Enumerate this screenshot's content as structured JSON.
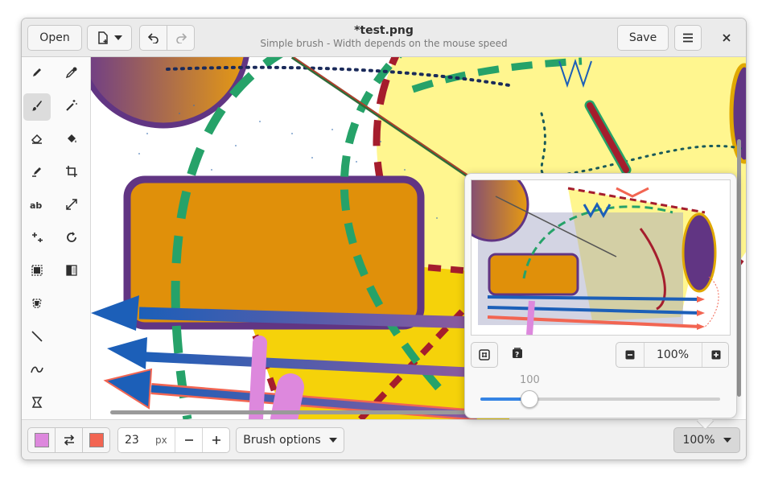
{
  "header": {
    "open_label": "Open",
    "title": "*test.png",
    "subtitle": "Simple brush - Width depends on the mouse speed",
    "save_label": "Save"
  },
  "tools": [
    {
      "name": "pencil",
      "icon": "pencil-icon",
      "active": false
    },
    {
      "name": "color-picker",
      "icon": "eyedropper-icon",
      "active": false
    },
    {
      "name": "brush",
      "icon": "brush-icon",
      "active": true
    },
    {
      "name": "magic-wand",
      "icon": "magic-wand-icon",
      "active": false
    },
    {
      "name": "eraser",
      "icon": "eraser-icon",
      "active": false
    },
    {
      "name": "paint-bucket",
      "icon": "paint-bucket-icon",
      "active": false
    },
    {
      "name": "highlighter",
      "icon": "highlighter-icon",
      "active": false
    },
    {
      "name": "crop",
      "icon": "crop-icon",
      "active": false
    },
    {
      "name": "text",
      "icon": "text-icon",
      "active": false
    },
    {
      "name": "scale",
      "icon": "scale-icon",
      "active": false
    },
    {
      "name": "points",
      "icon": "points-icon",
      "active": false
    },
    {
      "name": "rotate",
      "icon": "rotate-icon",
      "active": false
    },
    {
      "name": "rect-select",
      "icon": "rect-select-icon",
      "active": false
    },
    {
      "name": "filters",
      "icon": "filters-icon",
      "active": false
    },
    {
      "name": "free-select",
      "icon": "free-select-icon",
      "active": false
    },
    {
      "name": "line",
      "icon": "line-icon",
      "active": false
    },
    {
      "name": "curve",
      "icon": "curve-icon",
      "active": false
    },
    {
      "name": "free-shape",
      "icon": "free-shape-icon",
      "active": false
    }
  ],
  "bottombar": {
    "primary_color": "#dd88dd",
    "secondary_color": "#f26552",
    "size_value": "23",
    "size_unit": "px",
    "brush_options_label": "Brush options",
    "zoom_label": "100%"
  },
  "popover": {
    "zoom_value": "100%",
    "slider_label": "100",
    "slider_fraction": 0.2
  },
  "colors": {
    "accent": "#3584e4",
    "yellow": "#fff68f",
    "orange": "#e0900a",
    "purple": "#613583",
    "blue": "#1c5fb8",
    "green": "#26a269",
    "red": "#a51d2d"
  }
}
